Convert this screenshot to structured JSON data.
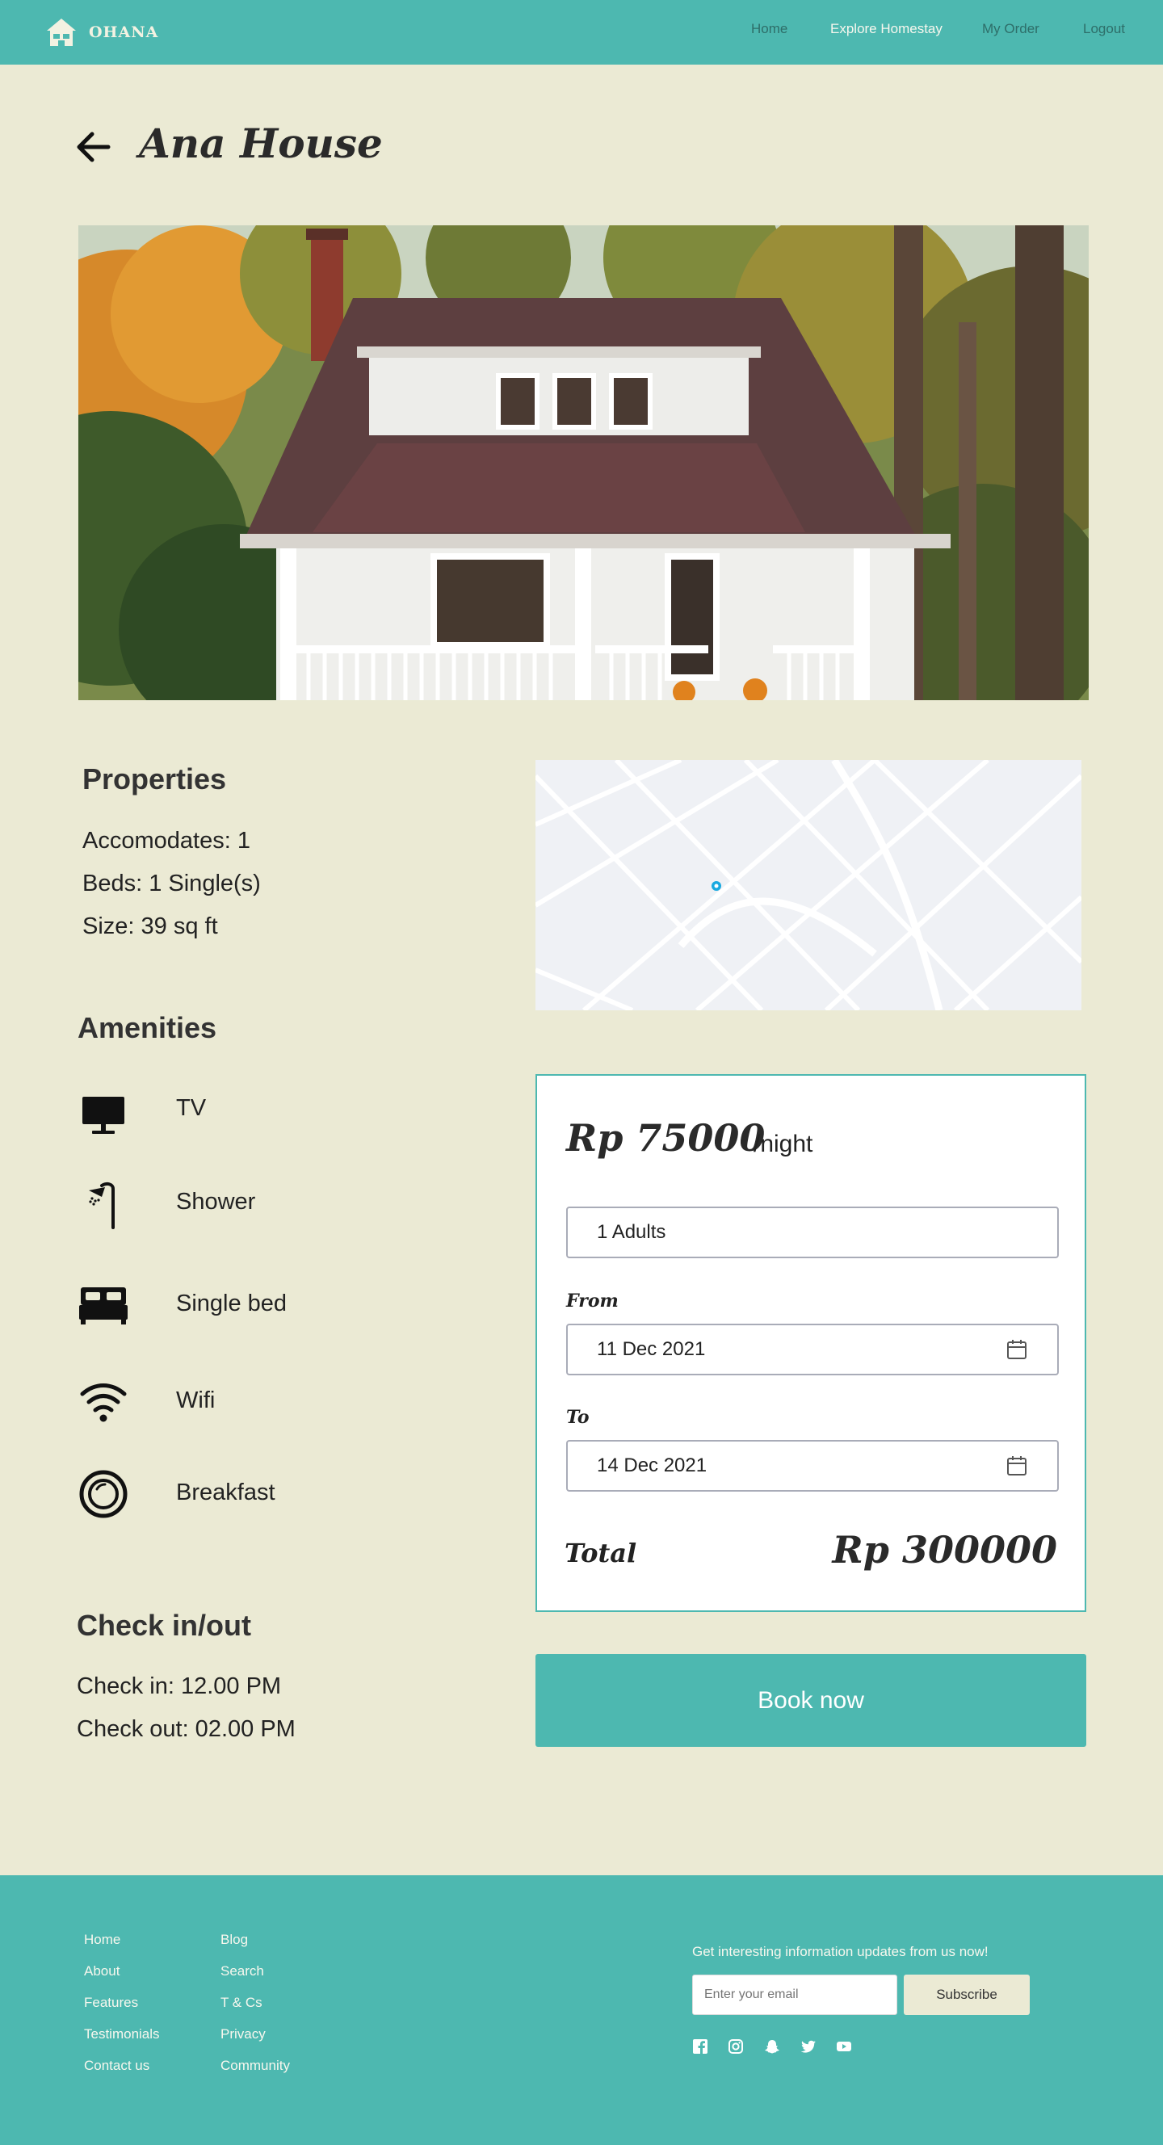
{
  "brand": {
    "name": "OHANA"
  },
  "nav": {
    "links": [
      {
        "label": "Home"
      },
      {
        "label": "Explore Homestay"
      },
      {
        "label": "My Order"
      },
      {
        "label": "Logout"
      }
    ]
  },
  "page": {
    "title": "Ana House"
  },
  "properties": {
    "heading": "Properties",
    "lines": [
      "Accomodates: 1",
      "Beds: 1 Single(s)",
      "Size: 39 sq ft"
    ]
  },
  "amenities": {
    "heading": "Amenities",
    "items": [
      {
        "label": "TV",
        "icon": "tv-icon"
      },
      {
        "label": "Shower",
        "icon": "shower-icon"
      },
      {
        "label": "Single bed",
        "icon": "bed-icon"
      },
      {
        "label": "Wifi",
        "icon": "wifi-icon"
      },
      {
        "label": "Breakfast",
        "icon": "breakfast-icon"
      }
    ]
  },
  "checkinout": {
    "heading": "Check in/out",
    "checkin": "Check in: 12.00 PM",
    "checkout": "Check out: 02.00 PM"
  },
  "booking": {
    "price": "Rp 75000",
    "per_night": "/night",
    "guests": "1 Adults",
    "from_label": "From",
    "from_value": "11 Dec 2021",
    "to_label": "To",
    "to_value": "14 Dec 2021",
    "total_label": "Total",
    "total_value": "Rp 300000",
    "book_label": "Book now"
  },
  "footer": {
    "col1": [
      "Home",
      "About",
      "Features",
      "Testimonials",
      "Contact us"
    ],
    "col2": [
      "Blog",
      "Search",
      "T & Cs",
      "Privacy",
      "Community"
    ],
    "newsletter_text": "Get interesting information updates from us now!",
    "email_placeholder": "Enter your email",
    "subscribe_label": "Subscribe",
    "social_icons": [
      "facebook-icon",
      "instagram-icon",
      "snapchat-icon",
      "twitter-icon",
      "youtube-icon"
    ]
  },
  "colors": {
    "teal": "#4DB8B0",
    "background": "#EBEAD4",
    "map_pin": "#19A9E0"
  }
}
